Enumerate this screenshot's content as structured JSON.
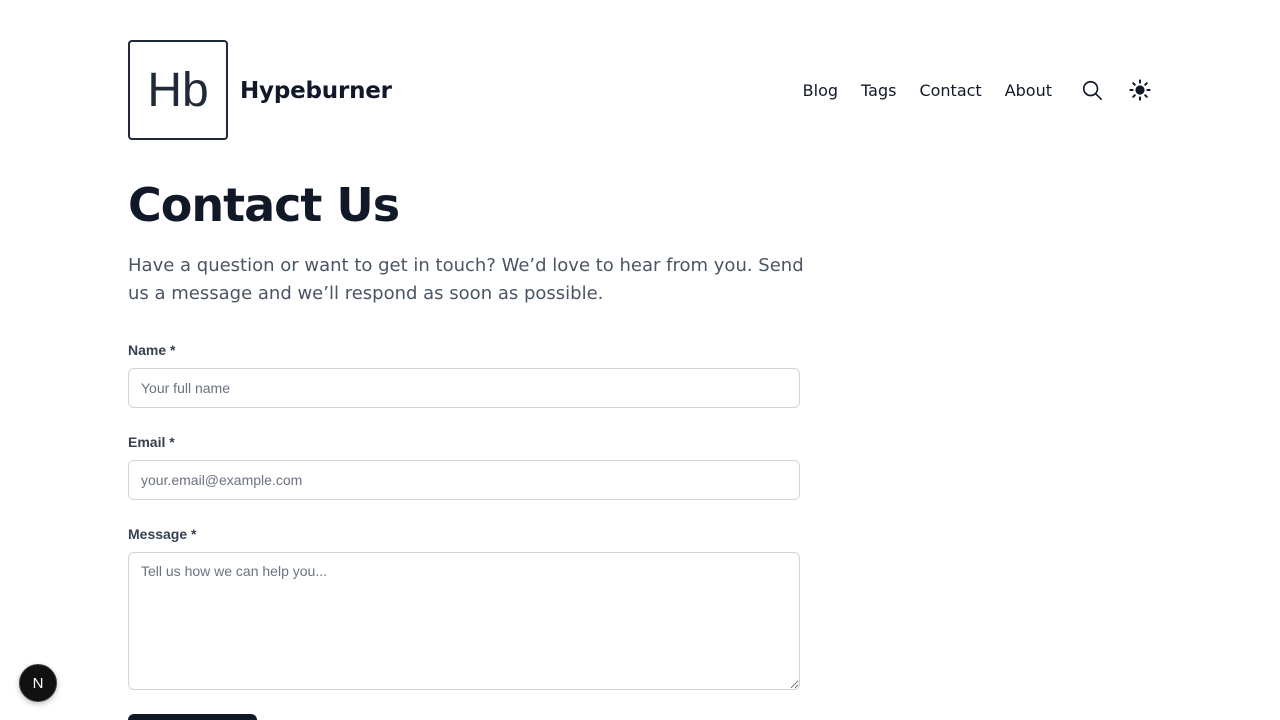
{
  "header": {
    "logo_text": "Hb",
    "site_name": "Hypeburner",
    "nav": [
      "Blog",
      "Tags",
      "Contact",
      "About"
    ],
    "icons": [
      "search-icon",
      "sun-icon"
    ]
  },
  "page": {
    "title": "Contact Us",
    "subtitle": "Have a question or want to get in touch? We’d love to hear from you. Send us a message and we’ll respond as soon as possible."
  },
  "form": {
    "name_label": "Name *",
    "name_placeholder": "Your full name",
    "email_label": "Email *",
    "email_placeholder": "your.email@example.com",
    "message_label": "Message *",
    "message_placeholder": "Tell us how we can help you..."
  },
  "dev_badge": {
    "label": "N"
  },
  "colors": {
    "text": "#111827",
    "muted": "#4b5563",
    "border": "#d1d5db",
    "button": "#111827"
  }
}
